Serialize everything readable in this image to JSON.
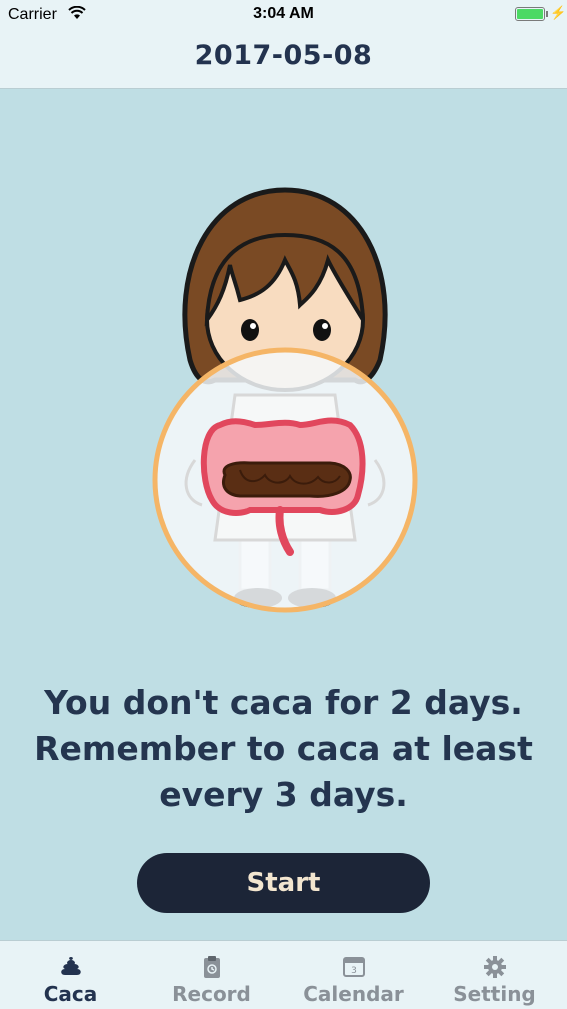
{
  "status_bar": {
    "carrier": "Carrier",
    "time": "3:04 AM"
  },
  "header": {
    "title": "2017-05-08"
  },
  "message": {
    "line1": "You don't caca for 2 days.",
    "line2": "Remember to caca at least",
    "line3": "every 3 days."
  },
  "start_button": {
    "label": "Start"
  },
  "tabs": [
    {
      "label": "Caca",
      "icon": "poop-icon",
      "active": true
    },
    {
      "label": "Record",
      "icon": "clipboard-icon",
      "active": false
    },
    {
      "label": "Calendar",
      "icon": "calendar-icon",
      "active": false,
      "icon_text": "3"
    },
    {
      "label": "Setting",
      "icon": "gear-icon",
      "active": false
    }
  ],
  "colors": {
    "background": "#bfdee4",
    "bar_background": "#e8f3f6",
    "title_text": "#23334f",
    "button_bg": "#1c2537",
    "button_text": "#f3e6cf",
    "circle_border": "#f5b566",
    "intestine": "#e1475d",
    "stool": "#5a2e14"
  }
}
